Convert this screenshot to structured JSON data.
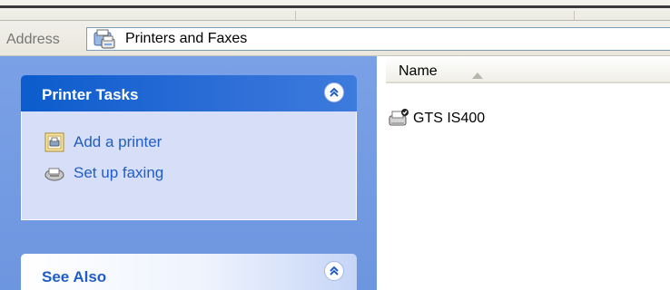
{
  "address_bar": {
    "label": "Address",
    "value": "Printers and Faxes",
    "icon": "printers-folder-icon"
  },
  "task_pane": {
    "printer_tasks": {
      "title": "Printer Tasks",
      "items": [
        {
          "label": "Add a printer",
          "icon": "add-printer-icon"
        },
        {
          "label": "Set up faxing",
          "icon": "fax-icon"
        }
      ]
    },
    "see_also": {
      "title": "See Also"
    }
  },
  "list": {
    "column_name": "Name",
    "sort": "ascending",
    "items": [
      {
        "name": "GTS IS400",
        "icon": "printer-default-icon"
      }
    ]
  },
  "colors": {
    "pane_background": "#7aa1e6",
    "panel_header": "#0c5ccd",
    "link": "#215dc6",
    "panel_body": "#d6dff7"
  }
}
